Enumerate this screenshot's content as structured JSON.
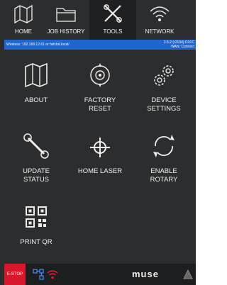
{
  "topnav": {
    "tabs": [
      {
        "label": "HOME",
        "icon": "home-map-icon",
        "active": false
      },
      {
        "label": "JOB HISTORY",
        "icon": "folder-icon",
        "active": false
      },
      {
        "label": "TOOLS",
        "icon": "tools-icon",
        "active": true
      },
      {
        "label": "NETWORK",
        "icon": "wifi-icon",
        "active": false
      }
    ]
  },
  "status": {
    "left": "Wireless: 192.168.12.61 or fsifcbd.local/",
    "right_line1": "2.5.2 (r2104) D1FC",
    "right_line2": "WAN: Connect"
  },
  "tools": [
    {
      "label": "ABOUT",
      "icon": "about-map-icon"
    },
    {
      "label": "FACTORY\nRESET",
      "icon": "factory-reset-icon"
    },
    {
      "label": "DEVICE\nSETTINGS",
      "icon": "gears-icon"
    },
    {
      "label": "UPDATE\nSTATUS",
      "icon": "wrench-icon"
    },
    {
      "label": "HOME LASER",
      "icon": "crosshair-icon"
    },
    {
      "label": "ENABLE\nROTARY",
      "icon": "rotary-icon"
    },
    {
      "label": "PRINT QR",
      "icon": "qr-icon"
    }
  ],
  "bottombar": {
    "estop_label": "E-STOP",
    "brand": "muse",
    "colors": {
      "estop": "#d8182a",
      "status_bar": "#1f66d1",
      "background": "#2b2d2f"
    }
  }
}
